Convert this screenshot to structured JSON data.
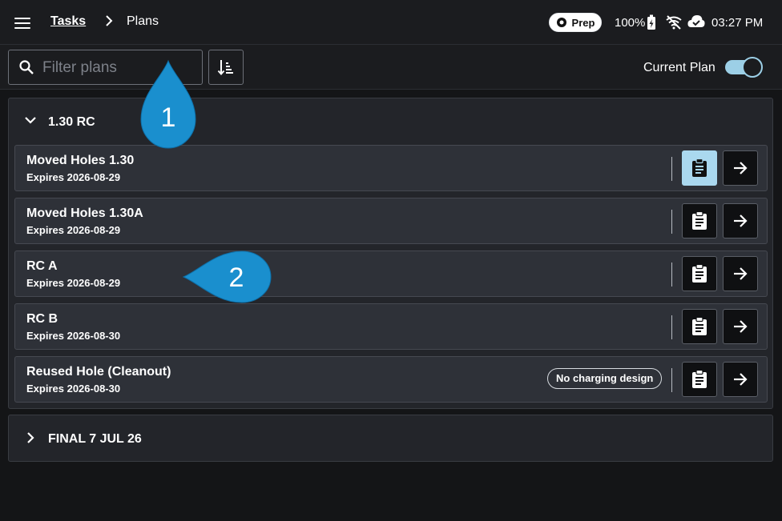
{
  "header": {
    "breadcrumb_root": "Tasks",
    "breadcrumb_current": "Plans",
    "mode_badge": "Prep",
    "battery": "100%",
    "time": "03:27 PM"
  },
  "filter": {
    "placeholder": "Filter plans",
    "toggle_label": "Current Plan",
    "toggle_on": true
  },
  "groups": [
    {
      "title": "1.30 RC",
      "expanded": true,
      "plans": [
        {
          "name": "Moved Holes 1.30",
          "expiry": "Expires 2026-08-29",
          "badge": "",
          "active": true
        },
        {
          "name": "Moved Holes 1.30A",
          "expiry": "Expires 2026-08-29",
          "badge": "",
          "active": false
        },
        {
          "name": "RC A",
          "expiry": "Expires 2026-08-29",
          "badge": "",
          "active": false
        },
        {
          "name": "RC B",
          "expiry": "Expires 2026-08-30",
          "badge": "",
          "active": false
        },
        {
          "name": "Reused Hole (Cleanout)",
          "expiry": "Expires 2026-08-30",
          "badge": "No charging design",
          "active": false
        }
      ]
    },
    {
      "title": "FINAL 7 JUL 26",
      "expanded": false,
      "plans": []
    }
  ],
  "callouts": [
    "1",
    "2"
  ],
  "colors": {
    "accent": "#aad8ef",
    "callout": "#1a8fce",
    "background": "#141517",
    "row": "#2e3138"
  }
}
